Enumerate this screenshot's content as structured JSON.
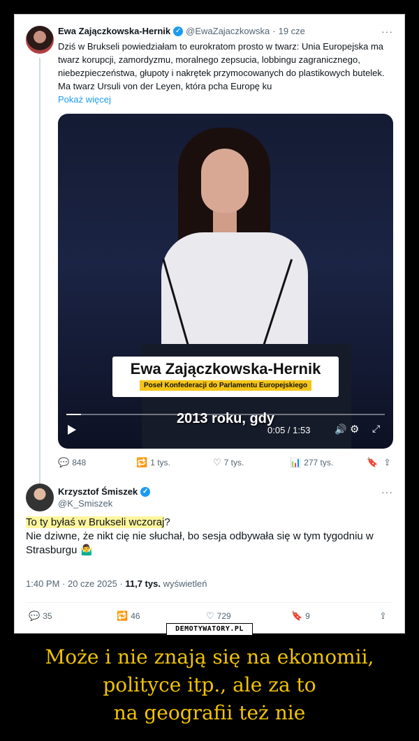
{
  "tweet1": {
    "author_name": "Ewa Zajączkowska-Hernik",
    "handle": "@EwaZajaczkowska",
    "time": "19 cze",
    "text": "Dziś w Brukseli powiedziałam to eurokratom prosto w twarz: Unia Europejska ma twarz korupcji, zamordyzmu, moralnego zepsucia, lobbingu zagranicznego, niebezpieczeństwa, głupoty i nakrętek przymocowanych do plastikowych butelek. Ma twarz Ursuli von der Leyen, która pcha Europę ku",
    "show_more": "Pokaż więcej",
    "video": {
      "lower_third_name": "Ewa Zajączkowska-Hernik",
      "lower_third_role": "Poseł Konfederacji do Parlamentu Europejskiego",
      "caption": "2013 roku, gdy",
      "time": "0:05 / 1:53",
      "progress": 0.045
    },
    "stats": {
      "replies": "848",
      "reposts": "1 tys.",
      "likes": "7 tys.",
      "views": "277 tys."
    }
  },
  "tweet2": {
    "author_name": "Krzysztof Śmiszek",
    "handle": "@K_Smiszek",
    "text_highlight": "To ty byłaś w Brukseli wczoraj",
    "text_after_highlight": "?",
    "text_rest": "Nie dziwne, że nikt cię nie słuchał, bo sesja odbywała się w tym tygodniu w Strasburgu",
    "meta_time": "1:40 PM · 20 cze 2025 · ",
    "meta_views": "11,7 tys.",
    "meta_views_label": " wyświetleń",
    "stats": {
      "replies": "35",
      "reposts": "46",
      "likes": "729",
      "bookmarks": "9"
    }
  },
  "watermark": "DEMOTYWATORY.PL",
  "bottom_caption": [
    "Może i nie znają się na ekonomii,",
    "polityce itp., ale za to",
    "na geografii też nie"
  ],
  "colors": {
    "accent": "#1d9bf0",
    "caption": "#f2c400",
    "highlight": "#fff59d"
  }
}
